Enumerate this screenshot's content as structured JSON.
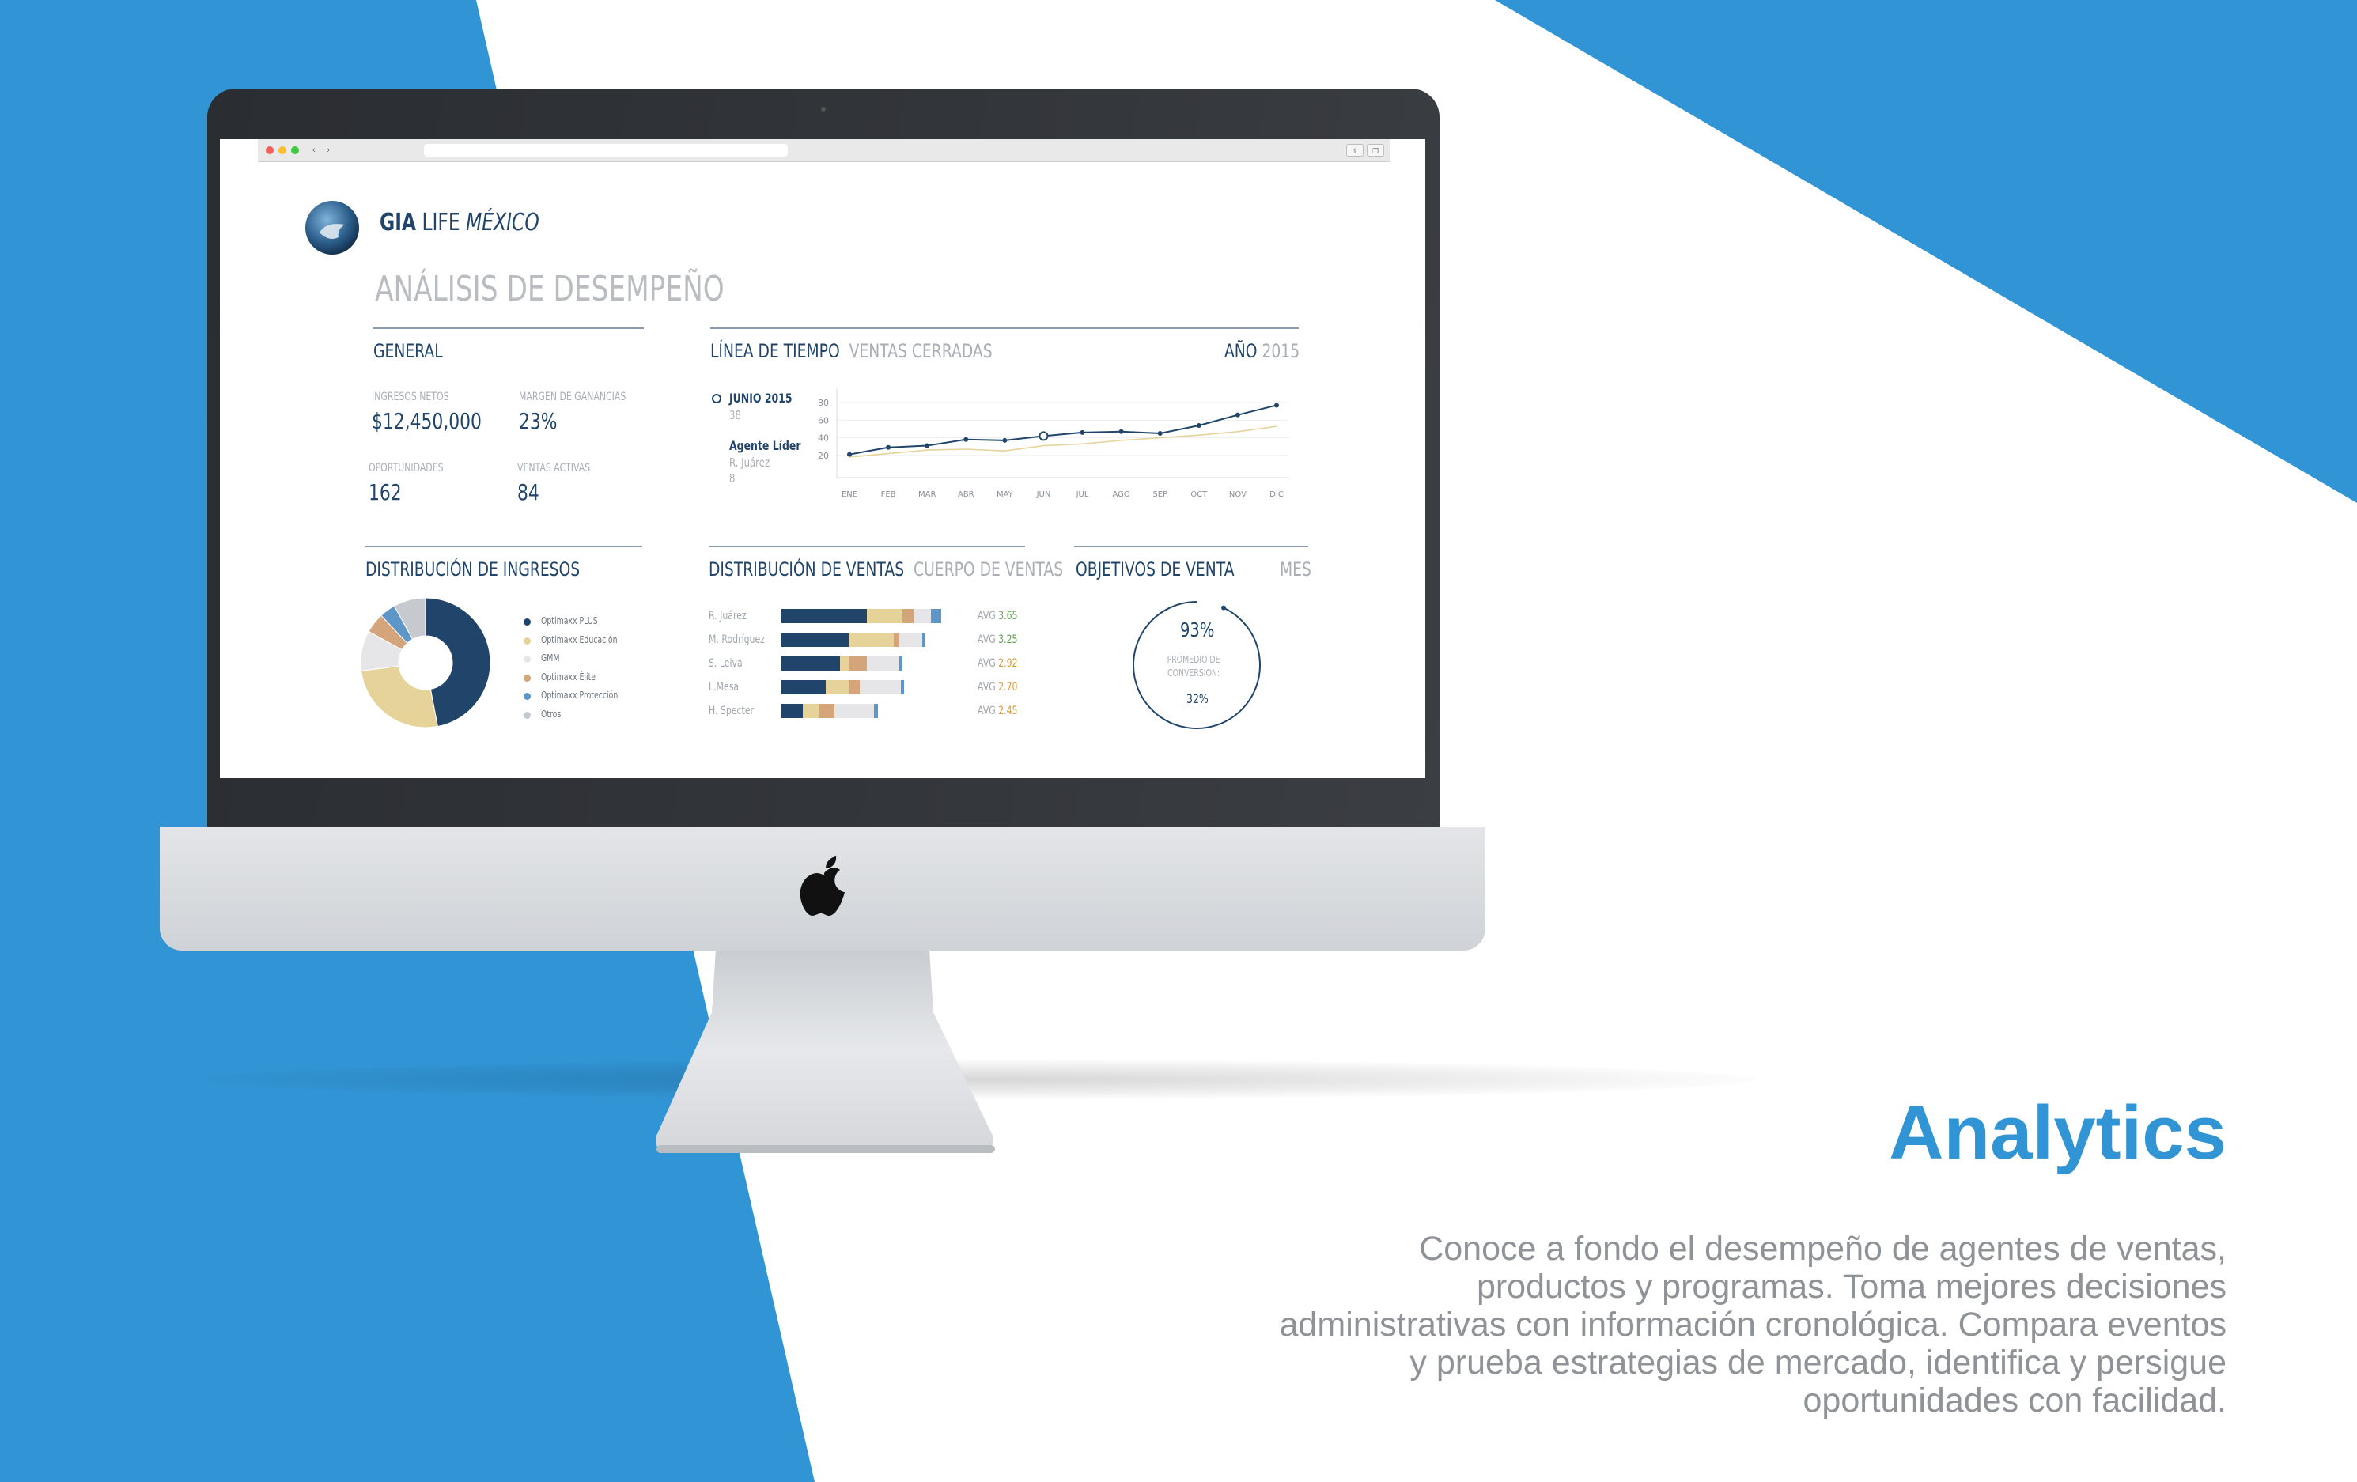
{
  "colors": {
    "blue": "#3194d4",
    "navy": "#21456a",
    "gold": "#e6d39a",
    "tan": "#d4a57a",
    "light_grey": "#e6e6e8",
    "mid_grey": "#c6c9ce",
    "steel_blue": "#5f96c8",
    "green": "#5aa24a",
    "orange": "#e2992f"
  },
  "icons": {
    "apple": "apple-logo-icon",
    "brand": "globe-logo-icon"
  },
  "brand": {
    "name_bold": "GIA",
    "name_regular": "LIFE",
    "name_italic": "MÉXICO"
  },
  "dashboard": {
    "title": "ANÁLISIS DE DESEMPEÑO",
    "general": {
      "title": "GENERAL",
      "kpis": [
        {
          "label": "INGRESOS NETOS",
          "value": "$12,450,000"
        },
        {
          "label": "MARGEN DE GANANCIAS",
          "value": "23%"
        },
        {
          "label": "OPORTUNIDADES",
          "value": "162"
        },
        {
          "label": "VENTAS ACTIVAS",
          "value": "84"
        }
      ]
    },
    "timeline": {
      "title": "LÍNEA DE TIEMPO",
      "subtitle": "VENTAS CERRADAS",
      "year_label": "AÑO",
      "year_value": "2015",
      "legend": {
        "period": "JUNIO 2015",
        "period_value": "38",
        "leader_label": "Agente Líder",
        "leader_name": "R. Juárez",
        "leader_value": "8"
      }
    },
    "income_distribution": {
      "title": "DISTRIBUCIÓN DE INGRESOS"
    },
    "sales_distribution": {
      "title": "DISTRIBUCIÓN DE VENTAS",
      "subtitle": "CUERPO DE VENTAS"
    },
    "sales_goals": {
      "title": "OBJETIVOS DE VENTA",
      "subtitle": "MES",
      "gauge_value": "93%",
      "gauge_label": "PROMEDIO DE CONVERSIÓN:",
      "gauge_secondary": "32%",
      "gauge_fraction": 0.93
    }
  },
  "chart_data": [
    {
      "type": "line",
      "x": [
        "ENE",
        "FEB",
        "MAR",
        "ABR",
        "MAY",
        "JUN",
        "JUL",
        "AGO",
        "SEP",
        "OCT",
        "NOV",
        "DIC"
      ],
      "ylim": [
        0,
        90
      ],
      "yticks": [
        "20",
        "40",
        "60",
        "80"
      ],
      "series": [
        {
          "values": [
            21,
            29,
            31,
            38,
            37,
            42,
            46,
            47,
            45,
            54,
            66,
            77
          ],
          "color": "#21456a"
        },
        {
          "values": [
            18,
            22,
            26,
            27,
            25,
            31,
            33,
            37,
            40,
            43,
            47,
            53
          ],
          "color": "#e6d39a"
        }
      ],
      "highlight_index": 5
    },
    {
      "type": "pie",
      "labels": [
        "Optimaxx PLUS",
        "Optimaxx Educación",
        "GMM",
        "Optimaxx Élite",
        "Optimaxx Protección",
        "Otros"
      ],
      "values": [
        47,
        26,
        10,
        5,
        4,
        8
      ],
      "colors": [
        "#21456a",
        "#e6d39a",
        "#e6e6e8",
        "#d4a57a",
        "#5f96c8",
        "#c6c9ce"
      ]
    },
    {
      "type": "bar",
      "orientation": "horizontal",
      "stacked": true,
      "categories": [
        "R. Juárez",
        "M. Rodríguez",
        "S. Leiva",
        "L.Mesa",
        "H. Specter"
      ],
      "series": [
        {
          "values": [
            60,
            47,
            41,
            31,
            15
          ],
          "color": "#21456a"
        },
        {
          "values": [
            25,
            32,
            7,
            16,
            11
          ],
          "color": "#e6d39a"
        },
        {
          "values": [
            8,
            4,
            12,
            8,
            11
          ],
          "color": "#d4a57a"
        },
        {
          "values": [
            12,
            16,
            23,
            29,
            28
          ],
          "color": "#e6e6e8"
        },
        {
          "values": [
            7,
            2,
            2,
            2,
            3
          ],
          "color": "#5f96c8"
        }
      ],
      "avg_label": "AVG",
      "avg_values": [
        "3.65",
        "3.25",
        "2.92",
        "2.70",
        "2.45"
      ],
      "avg_colors": [
        "#5aa24a",
        "#5aa24a",
        "#e2992f",
        "#e2992f",
        "#e2992f"
      ]
    }
  ],
  "promo": {
    "title": "Analytics",
    "body": "Conoce a fondo el desempeño de agentes de ventas, productos y programas. Toma mejores decisiones administrativas con información cronológica. Compara eventos y prueba estrategias de mercado, identifica y persigue oportunidades con facilidad."
  }
}
